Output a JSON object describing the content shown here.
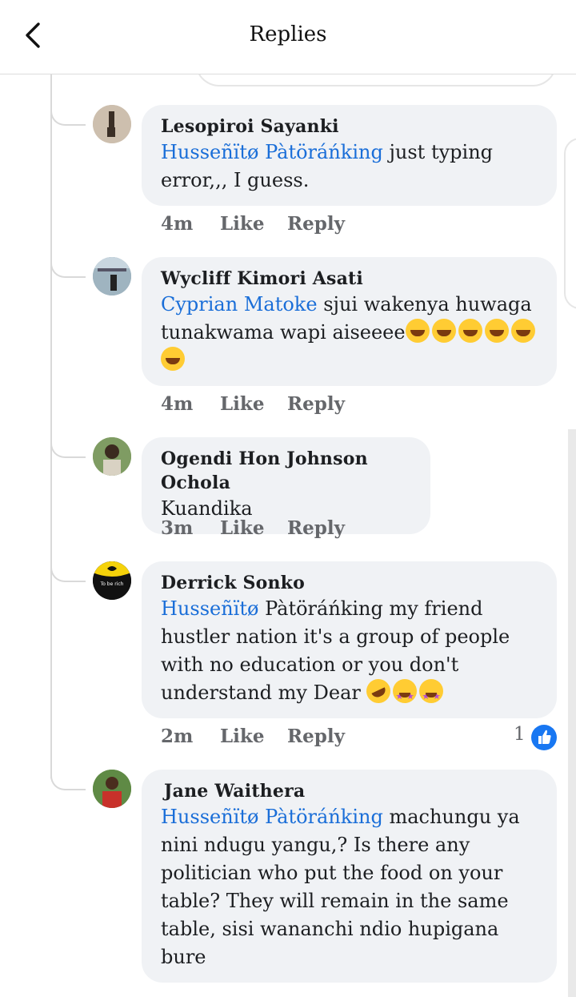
{
  "header": {
    "title": "Replies"
  },
  "comments": [
    {
      "author": "Lesopiroi Sayanki",
      "mention": "Husseñïtø Pàtöráńking",
      "text": " just typing error,,, I guess.",
      "time": "4m"
    },
    {
      "author": "Wycliff Kimori Asati",
      "mention": "Cyprian Matoke",
      "text": " sjui wakenya huwaga tunakwama wapi aiseeee",
      "time": "4m"
    },
    {
      "author": "Ogendi Hon  Johnson Ochola",
      "mention": "",
      "text": "Kuandika",
      "time": "3m"
    },
    {
      "author": "Derrick Sonko",
      "mention": "Husseñïtø",
      "text": " Pàtöráńking my friend hustler nation it's a group of people with no education or you don't understand my Dear ",
      "time": "2m",
      "reaction_count": "1"
    },
    {
      "author": "Jane Waithera",
      "mention": "Husseñïtø Pàtöráńking",
      "text": " machungu ya nini ndugu yangu,? Is there any politician who put the food on your table? They will remain in the same table, sisi wananchi ndio hupigana bure"
    }
  ],
  "actions": {
    "like": "Like",
    "reply": "Reply"
  },
  "avatar_text": {
    "derrick": "To be rich"
  },
  "colors": {
    "mention": "#1a6ed8",
    "bubble": "#f0f2f5",
    "like_icon": "#1877f2"
  }
}
